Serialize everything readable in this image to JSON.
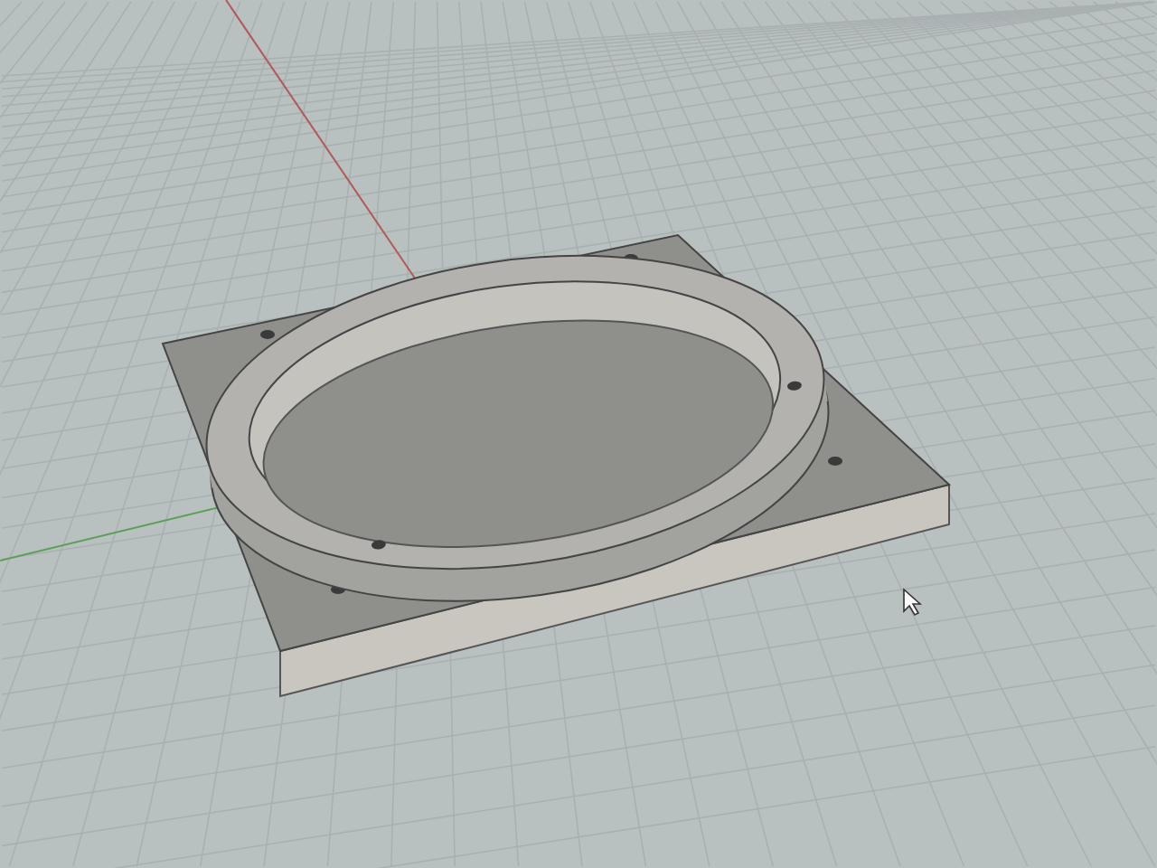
{
  "viewport": {
    "grid": true,
    "world_axes": true,
    "cursor": true
  }
}
